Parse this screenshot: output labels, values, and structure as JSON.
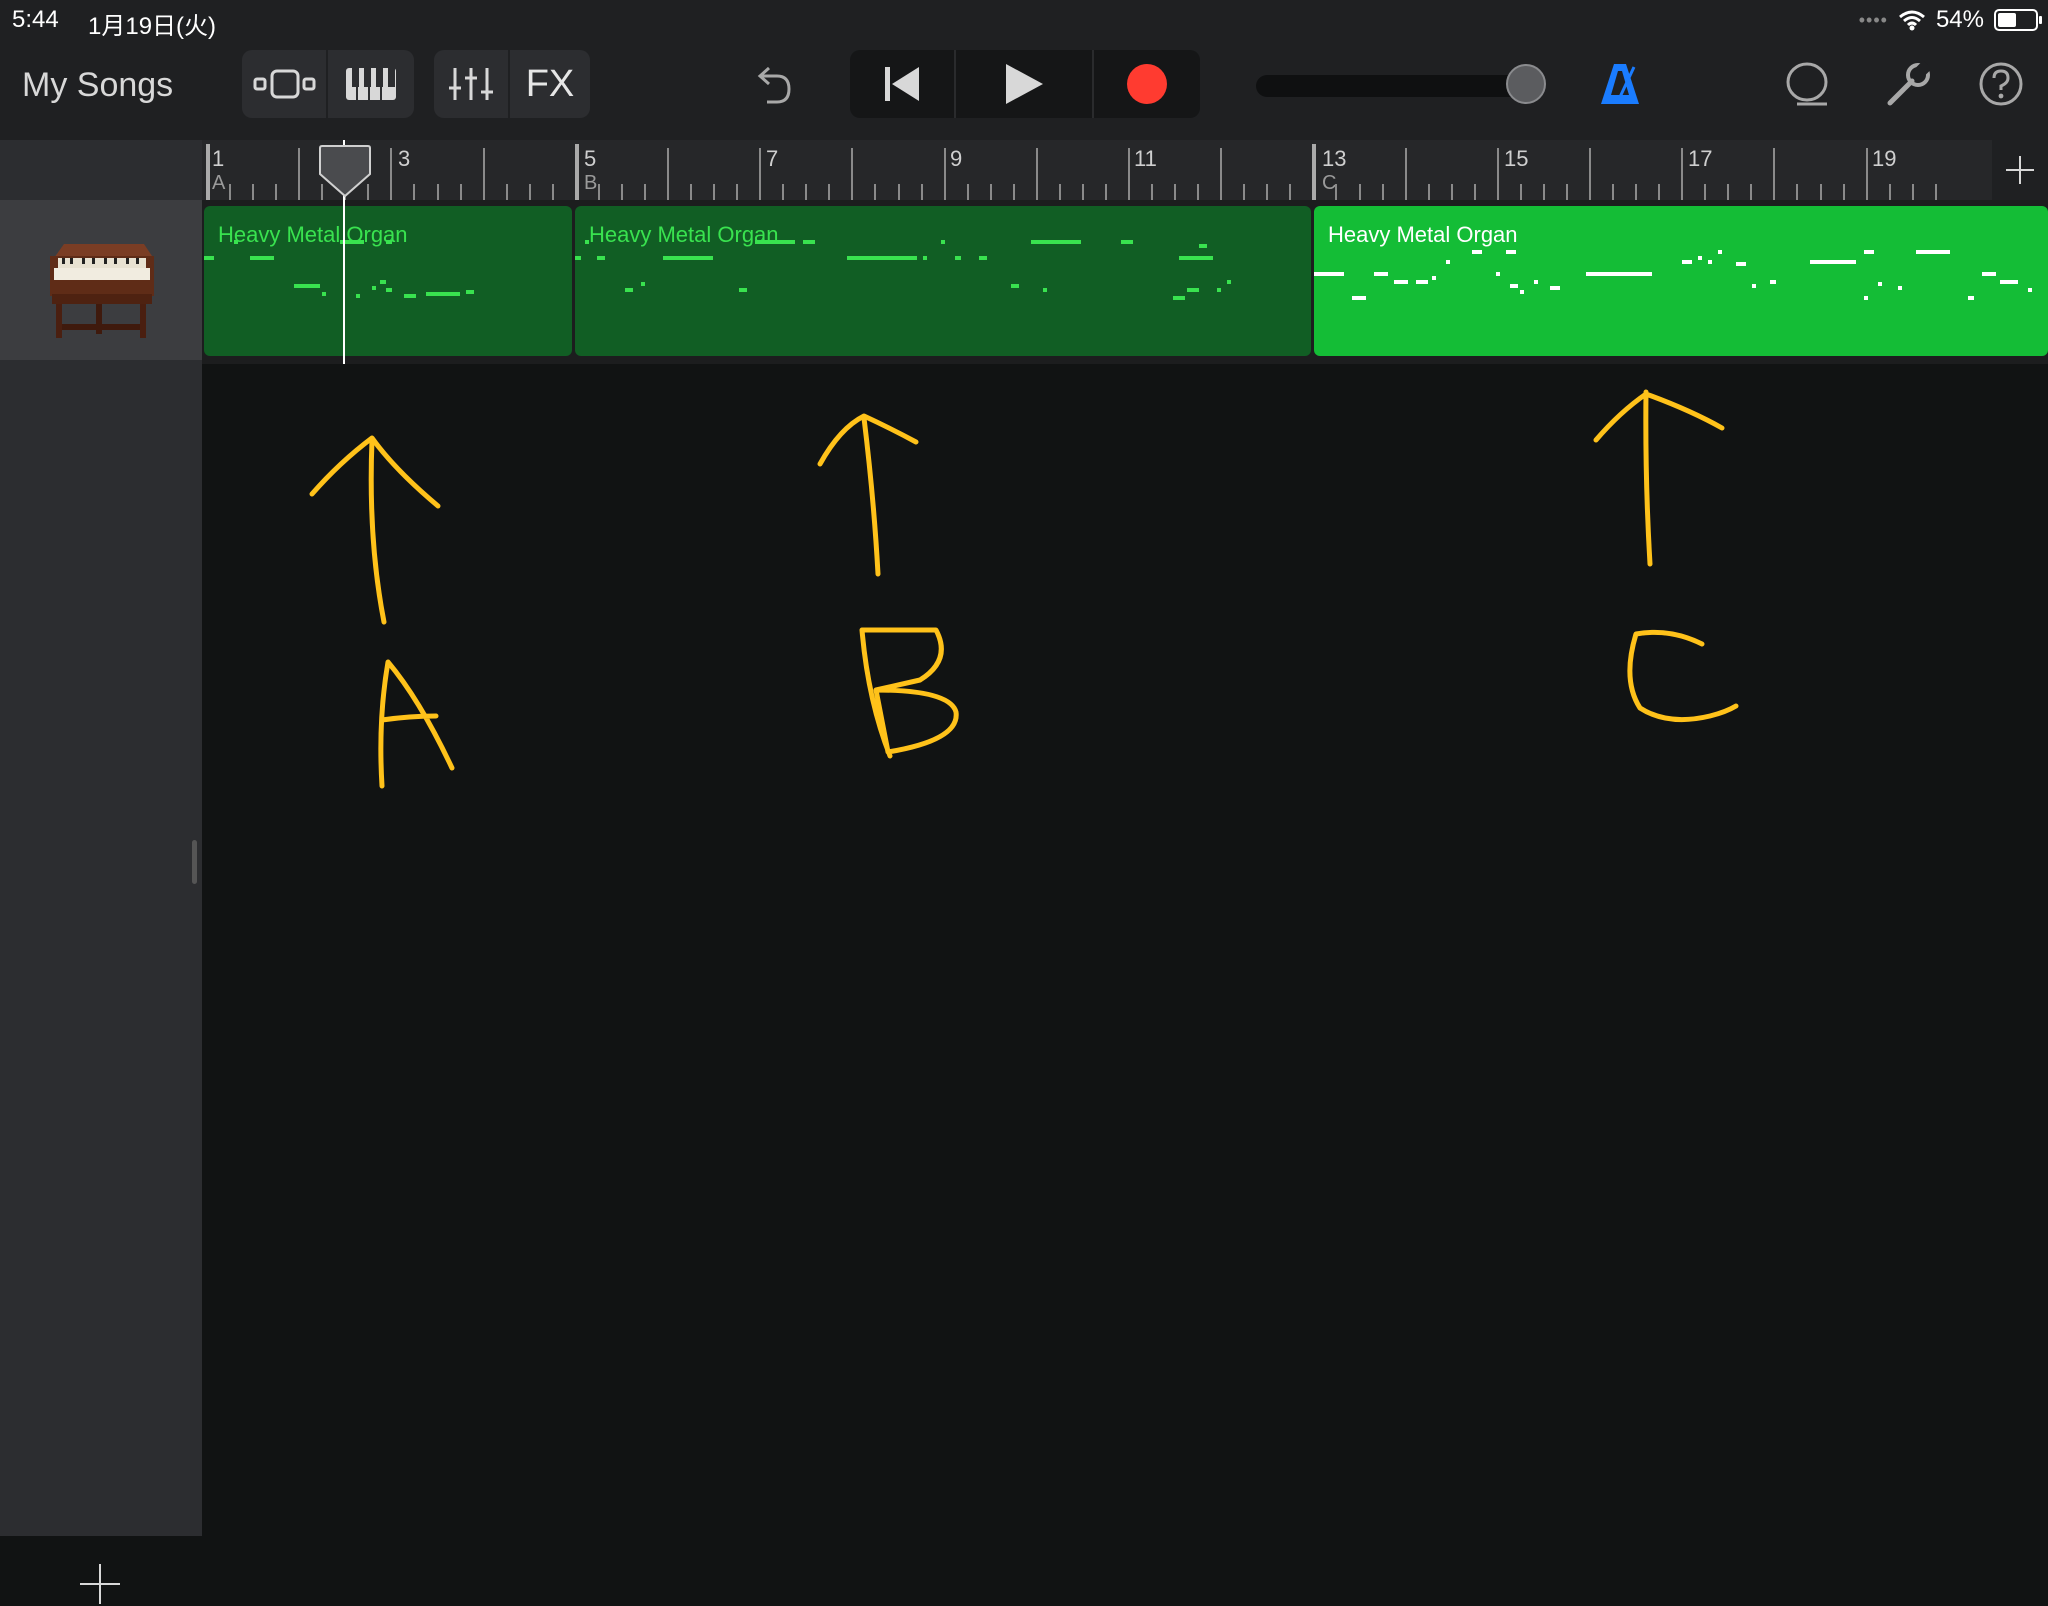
{
  "status_bar": {
    "time": "5:44",
    "date": "1月19日(火)",
    "battery": "54%",
    "battery_level": 0.54
  },
  "toolbar": {
    "my_songs": "My Songs",
    "fx_label": "FX",
    "icons": [
      "tracks-view-icon",
      "instrument-keyboard-icon",
      "mixer-icon",
      "fx-icon",
      "undo-icon",
      "rewind-icon",
      "play-icon",
      "record-icon",
      "master-volume-slider",
      "metronome-icon",
      "loop-icon",
      "settings-wrench-icon",
      "help-icon"
    ],
    "colors": {
      "record": "#ff3b30",
      "metronome": "#1a7cff"
    }
  },
  "ruler": {
    "bars": [
      "1",
      "3",
      "5",
      "7",
      "9",
      "11",
      "13",
      "15",
      "17",
      "19"
    ],
    "sections": [
      "A",
      "B",
      "C"
    ]
  },
  "track": {
    "instrument_icon": "organ-icon",
    "regions": [
      {
        "name": "Heavy Metal Organ",
        "section": "A",
        "selected": false
      },
      {
        "name": "Heavy Metal Organ",
        "section": "B",
        "selected": false
      },
      {
        "name": "Heavy Metal Organ",
        "section": "C",
        "selected": true
      }
    ],
    "colors": {
      "region": "#115e24",
      "region_selected": "#14bd36",
      "notes": "#39e24f",
      "notes_selected": "#ffffff"
    }
  },
  "annotations": {
    "labels": [
      "A",
      "B",
      "C"
    ],
    "color": "#ffc21a"
  }
}
